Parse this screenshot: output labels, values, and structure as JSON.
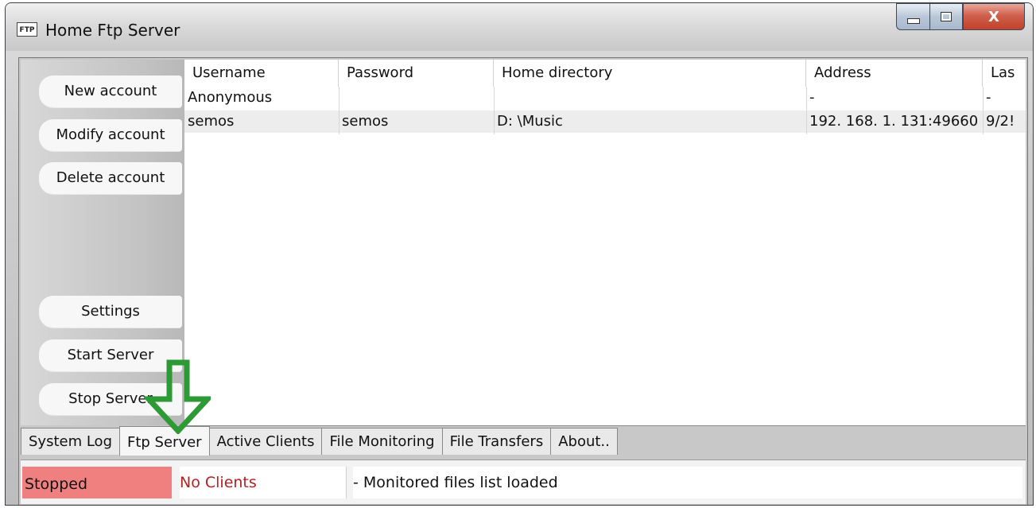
{
  "window": {
    "icon_text": "FTP",
    "title": "Home Ftp Server",
    "close_glyph": "X"
  },
  "sidebar": {
    "buttons": [
      {
        "label": "New account"
      },
      {
        "label": "Modify account"
      },
      {
        "label": "Delete account"
      },
      {
        "label": "Settings"
      },
      {
        "label": "Start Server"
      },
      {
        "label": "Stop Server"
      }
    ]
  },
  "table": {
    "columns": [
      "Username",
      "Password",
      "Home directory",
      "Address",
      "Las"
    ],
    "rows": [
      [
        "Anonymous",
        "",
        "",
        "-",
        "-"
      ],
      [
        "semos",
        "semos",
        "D: \\Music",
        "192. 168. 1. 131:49660",
        "9/2!"
      ]
    ]
  },
  "tabs": [
    {
      "label": "System Log"
    },
    {
      "label": "Ftp Server",
      "active": true
    },
    {
      "label": "Active Clients"
    },
    {
      "label": "File Monitoring"
    },
    {
      "label": "File Transfers"
    },
    {
      "label": "About.."
    }
  ],
  "status": {
    "state": "Stopped",
    "clients": "No Clients",
    "message": "- Monitored files list loaded"
  },
  "colors": {
    "stopped_bg": "#f08080",
    "no_clients_text": "#b22222",
    "annotation_arrow": "#2e9a35"
  },
  "annotation": {
    "icon": "down-arrow-icon"
  }
}
